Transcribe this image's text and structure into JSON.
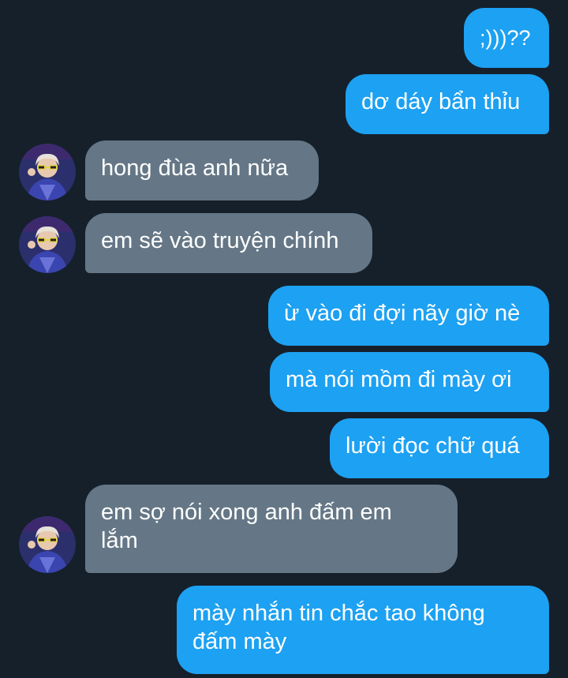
{
  "messages": [
    {
      "side": "sent",
      "text": ";)))??"
    },
    {
      "side": "sent",
      "text": "dơ dáy bẩn thỉu"
    },
    {
      "side": "received",
      "text": "hong đùa anh nữa"
    },
    {
      "side": "received",
      "text": "em sẽ vào truyện chính"
    },
    {
      "side": "sent",
      "text": "ừ vào đi đợi nãy giờ nè"
    },
    {
      "side": "sent",
      "text": "mà nói mồm đi mày ơi"
    },
    {
      "side": "sent",
      "text": "lười đọc chữ quá"
    },
    {
      "side": "received",
      "text": "em sợ nói xong anh đấm em\nlắm"
    },
    {
      "side": "sent",
      "text": "mày nhắn tin chắc tao không\nđấm mày"
    }
  ],
  "avatar_icon": "user-avatar-photo",
  "colors": {
    "background": "#15202b",
    "sent_bubble": "#1da1f2",
    "received_bubble": "#657786",
    "text": "#ffffff"
  }
}
